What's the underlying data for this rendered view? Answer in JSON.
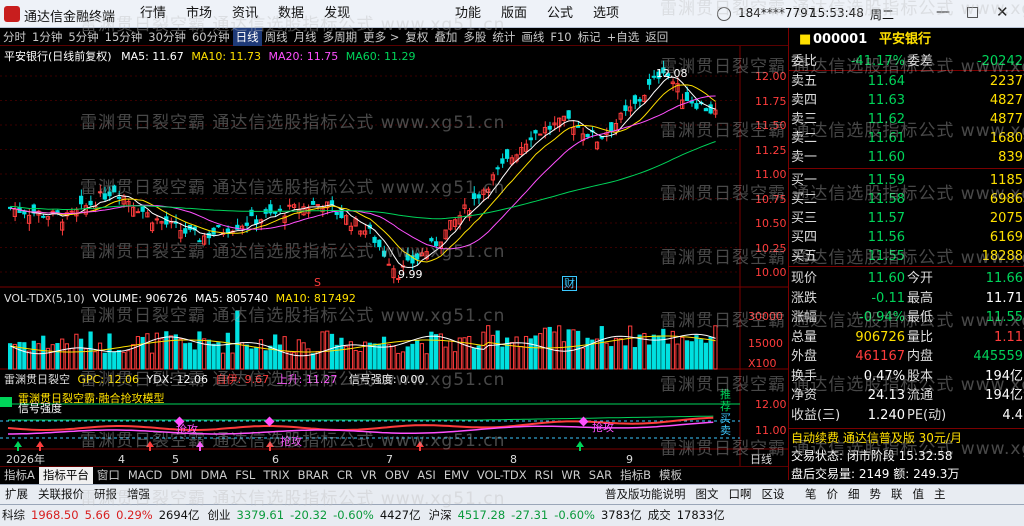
{
  "window": {
    "app_title": "通达信金融终端",
    "menus": [
      "行情",
      "市场",
      "资讯",
      "数据",
      "发现",
      "功能",
      "版面",
      "公式",
      "选项"
    ],
    "user": "184****7797",
    "time": "15:53:48",
    "weekday": "周二"
  },
  "toolbar": {
    "items": [
      "分时",
      "1分钟",
      "5分钟",
      "15分钟",
      "30分钟",
      "60分钟",
      "日线",
      "周线",
      "月线",
      "多周期",
      "更多 >",
      "复权",
      "叠加",
      "多股",
      "统计",
      "画线",
      "F10",
      "标记",
      "+自选",
      "返回"
    ],
    "active": "日线"
  },
  "main_chart": {
    "title": "平安银行(日线前复权)",
    "ma5_label": "MA5: 11.67",
    "ma10_label": "MA10: 11.73",
    "ma20_label": "MA20: 11.75",
    "ma60_label": "MA60: 11.29",
    "high_label": "12.08",
    "low_label": "9.99",
    "y_ticks": [
      "12.00",
      "11.75",
      "11.50",
      "11.25",
      "11.00",
      "10.75",
      "10.50",
      "10.25",
      "10.00"
    ],
    "marker_s": "S",
    "marker_cai": "财",
    "watermark": "雷渊贯日裂空霸 通达信选股指标公式 www.xg51.cn"
  },
  "volume_chart": {
    "title": "VOL-TDX(5,10)",
    "volume_label": "VOLUME: 906726",
    "ma5_label": "MA5: 805740",
    "ma10_label": "MA10: 817492",
    "y_ticks": [
      "30000",
      "15000",
      "X100"
    ]
  },
  "indicator_chart": {
    "title": "雷渊贯日裂空",
    "gpc_label": "GPC: 12.06",
    "ydx_label": "YDX: 12.06",
    "extra1": "自伊: 9.67",
    "extra2": "上升: 11.27",
    "strength_label": "信号强度: 0.00",
    "legend_line1": "雷渊贯日裂空霸·融合抢攻模型",
    "legend_line2": "信号强度",
    "qianggong": "抢攻",
    "y_ticks": [
      "12.00",
      "11.00"
    ],
    "side_labels": [
      "推",
      "荐",
      "买",
      "卖"
    ]
  },
  "x_axis": {
    "labels": [
      "2026年",
      "4",
      "5",
      "6",
      "7",
      "8",
      "9"
    ],
    "right_label": "日线"
  },
  "indicator_tabs": {
    "items": [
      "指标A",
      "指标平台",
      "窗口",
      "MACD",
      "DMI",
      "DMA",
      "FSL",
      "TRIX",
      "BRAR",
      "CR",
      "VR",
      "OBV",
      "ASI",
      "EMV",
      "VOL-TDX",
      "RSI",
      "WR",
      "SAR",
      "指标B",
      "模板"
    ],
    "active": "指标平台"
  },
  "bottom_tabs": {
    "items": [
      "扩展",
      "关联报价",
      "研报",
      "增强"
    ],
    "right_items": [
      "普及版功能说明",
      "图文",
      "口啊",
      "区设"
    ]
  },
  "right_panel": {
    "code": "000001",
    "name": "平安银行",
    "order_ratio_label": "委比",
    "order_ratio": "-41.17%",
    "order_diff_label": "委差",
    "order_diff": "-20242",
    "asks": [
      {
        "label": "卖五",
        "price": "11.64",
        "vol": "2237"
      },
      {
        "label": "卖四",
        "price": "11.63",
        "vol": "4827"
      },
      {
        "label": "卖三",
        "price": "11.62",
        "vol": "4877"
      },
      {
        "label": "卖二",
        "price": "11.61",
        "vol": "1680"
      },
      {
        "label": "卖一",
        "price": "11.60",
        "vol": "839"
      }
    ],
    "bids": [
      {
        "label": "买一",
        "price": "11.59",
        "vol": "1185"
      },
      {
        "label": "买二",
        "price": "11.58",
        "vol": "6986"
      },
      {
        "label": "买三",
        "price": "11.57",
        "vol": "2075"
      },
      {
        "label": "买四",
        "price": "11.56",
        "vol": "6169"
      },
      {
        "label": "买五",
        "price": "11.55",
        "vol": "18288"
      }
    ],
    "stats": [
      {
        "k": "现价",
        "v": "11.60",
        "c1": "green",
        "k2": "今开",
        "v2": "11.66",
        "c2": "green"
      },
      {
        "k": "涨跌",
        "v": "-0.11",
        "c1": "green",
        "k2": "最高",
        "v2": "11.71",
        "c2": "white"
      },
      {
        "k": "涨幅",
        "v": "-0.94%",
        "c1": "green",
        "k2": "最低",
        "v2": "11.55",
        "c2": "green"
      },
      {
        "k": "总量",
        "v": "906726",
        "c1": "yellow",
        "k2": "量比",
        "v2": "1.11",
        "c2": "red"
      },
      {
        "k": "外盘",
        "v": "461167",
        "c1": "red",
        "k2": "内盘",
        "v2": "445559",
        "c2": "green"
      },
      {
        "k": "换手",
        "v": "0.47%",
        "c1": "white",
        "k2": "股本",
        "v2": "194亿",
        "c2": "white"
      },
      {
        "k": "净资",
        "v": "24.13",
        "c1": "white",
        "k2": "流通",
        "v2": "194亿",
        "c2": "white"
      },
      {
        "k": "收益(三)",
        "v": "1.240",
        "c1": "white",
        "k2": "PE(动)",
        "v2": "4.4",
        "c2": "white"
      }
    ],
    "ad_text": "自动续费 通达信普及版 30元/月",
    "trade_status": "交易状态: 闭市阶段  15:32:58",
    "after_hours": "盘后交易量: 2149  额: 249.3万",
    "tabs": [
      "笔",
      "价",
      "细",
      "势",
      "联",
      "值",
      "主"
    ]
  },
  "statusbar": {
    "items": [
      {
        "name": "科综",
        "val": "1968.50",
        "chg": "5.66",
        "pct": "0.29%",
        "amt": "2694亿",
        "color": "red"
      },
      {
        "name": "创业",
        "val": "3379.61",
        "chg": "-20.32",
        "pct": "-0.60%",
        "amt": "4427亿",
        "color": "green"
      },
      {
        "name": "沪深",
        "val": "4517.28",
        "chg": "-27.31",
        "pct": "-0.60%",
        "amt": "3783亿",
        "color": "green"
      }
    ],
    "tail_label": "成交",
    "tail_val": "17833亿"
  },
  "colors": {
    "up": "#ff3c3c",
    "down": "#00e0e0",
    "ma5": "#ffffff",
    "ma10": "#ffe000",
    "ma20": "#ff50ff",
    "ma60": "#00d45a"
  }
}
